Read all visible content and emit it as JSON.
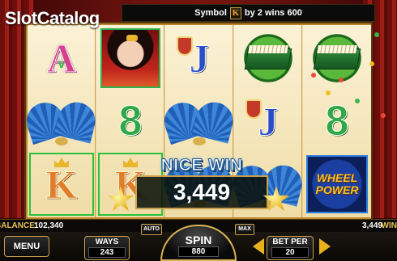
{
  "logo": {
    "slot": "Slot",
    "catalog": "Catalog"
  },
  "message": {
    "prefix": "Symbol",
    "symbol": "K",
    "suffix": "by 2 wins 600"
  },
  "reels": [
    [
      "A",
      "fan",
      "K"
    ],
    [
      "geisha",
      "8",
      "K"
    ],
    [
      "J",
      "fan",
      "fan"
    ],
    [
      "mahjong",
      "J",
      ""
    ],
    [
      "mahjong",
      "8",
      "wheel"
    ]
  ],
  "wheel": {
    "line1": "WHEEL",
    "line2": "POWER"
  },
  "big_win": {
    "title": "NICE WIN",
    "amount": "3,449"
  },
  "balance": {
    "label": "BALANCE",
    "value": "102,340"
  },
  "win": {
    "label": "WIN",
    "value": "3,449"
  },
  "controls": {
    "menu": "MENU",
    "ways_label": "WAYS",
    "ways_value": "243",
    "auto": "AUTO",
    "max": "MAX",
    "spin_label": "SPIN",
    "spin_value": "880",
    "bet_label": "BET PER",
    "bet_value": "20"
  },
  "colors": {
    "accent_gold": "#c9a050",
    "win_highlight": "#29c23a"
  }
}
